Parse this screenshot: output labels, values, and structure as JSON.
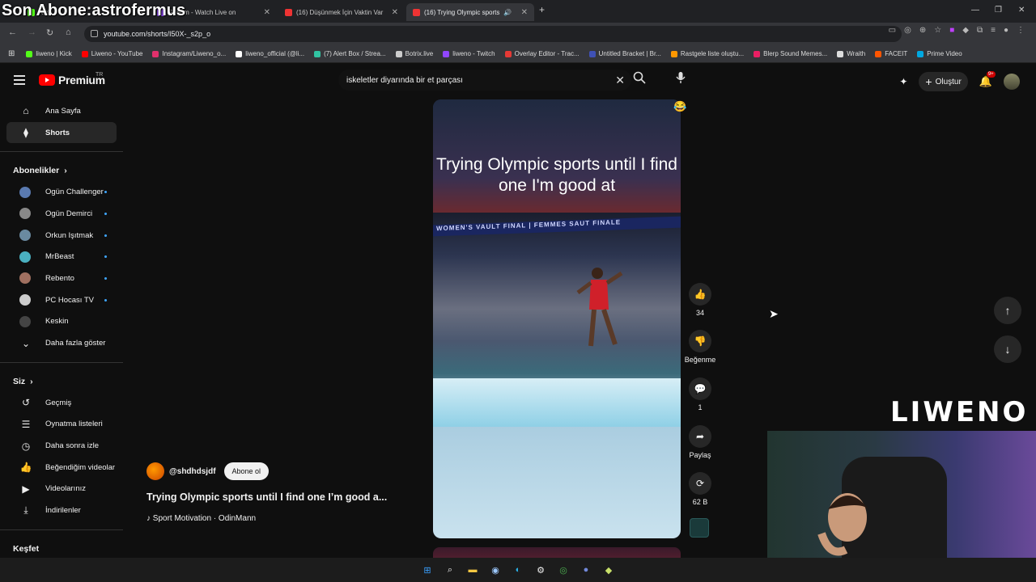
{
  "stream_overlay": {
    "text": "Son Abone:astrofermus",
    "brand": "LIWENO"
  },
  "browser": {
    "tabs": [
      {
        "label": "Kick",
        "active": false
      },
      {
        "label": "Stream - Watch Live on",
        "active": false
      },
      {
        "label": "(16) Düşünmek İçin Vaktin Var",
        "active": false
      },
      {
        "label": "(16) Trying Olympic sports",
        "active": true
      }
    ],
    "url": "youtube.com/shorts/I50X-_s2p_o",
    "bookmarks": [
      {
        "label": "liweno | Kick",
        "color": "#53fc18"
      },
      {
        "label": "Liweno - YouTube",
        "color": "#ff0000"
      },
      {
        "label": "Instagram/Liweno_o...",
        "color": "#e1306c"
      },
      {
        "label": "liweno_official (@li...",
        "color": "#ffffff"
      },
      {
        "label": "(7) Alert Box / Strea...",
        "color": "#31c3a2"
      },
      {
        "label": "Botrix.live",
        "color": "#cccccc"
      },
      {
        "label": "liweno - Twitch",
        "color": "#9146ff"
      },
      {
        "label": "Overlay Editor - Trac...",
        "color": "#e53935"
      },
      {
        "label": "Untitled Bracket | Br...",
        "color": "#3f51b5"
      },
      {
        "label": "Rastgele liste oluştu...",
        "color": "#ff9800"
      },
      {
        "label": "Blerp Sound Memes...",
        "color": "#e91e63"
      },
      {
        "label": "Wraith",
        "color": "#dddddd"
      },
      {
        "label": "FACEIT",
        "color": "#ff5500"
      },
      {
        "label": "Prime Video",
        "color": "#00a8e1"
      }
    ]
  },
  "youtube": {
    "logo_text": "Premium",
    "region": "TR",
    "search_value": "iskeletler diyarında bir et parçası",
    "create_label": "Oluştur",
    "notif_badge": "9+"
  },
  "sidebar": {
    "main": [
      {
        "label": "Ana Sayfa",
        "icon": "home-icon"
      },
      {
        "label": "Shorts",
        "icon": "shorts-icon",
        "active": true
      }
    ],
    "subs_title": "Abonelikler",
    "subs": [
      {
        "label": "Ogün Challenger",
        "color": "#5a7ab0",
        "dot": true
      },
      {
        "label": "Ogün Demirci",
        "color": "#888888",
        "dot": true
      },
      {
        "label": "Orkun Işıtmak",
        "color": "#6a8aa0",
        "dot": true
      },
      {
        "label": "MrBeast",
        "color": "#4ab0c0",
        "dot": true
      },
      {
        "label": "Rebento",
        "color": "#a07060",
        "dot": true
      },
      {
        "label": "PC Hocası TV",
        "color": "#cccccc",
        "dot": true
      },
      {
        "label": "Keskin",
        "color": "#444444",
        "dot": false
      }
    ],
    "more_label": "Daha fazla göster",
    "you_title": "Siz",
    "you": [
      {
        "label": "Geçmiş",
        "icon": "history-icon"
      },
      {
        "label": "Oynatma listeleri",
        "icon": "playlist-icon"
      },
      {
        "label": "Daha sonra izle",
        "icon": "clock-icon"
      },
      {
        "label": "Beğendiğim videolar",
        "icon": "like-icon"
      },
      {
        "label": "Videolarınız",
        "icon": "video-icon"
      },
      {
        "label": "İndirilenler",
        "icon": "download-icon"
      }
    ],
    "explore_title": "Keşfet"
  },
  "short": {
    "caption": "Trying Olympic sports until I find one I'm good at",
    "banner": "WOMEN'S VAULT FINAL | FEMMES SAUT FINALE",
    "channel": "@shdhdsjdf",
    "subscribe_label": "Abone ol",
    "title": "Trying Olympic sports until I find one I’m good a...",
    "sound": "Sport Motivation · OdinMann",
    "likes": "34",
    "dislike_label": "Beğenme",
    "comments": "1",
    "share_label": "Paylaş",
    "remix_count": "62 B"
  }
}
